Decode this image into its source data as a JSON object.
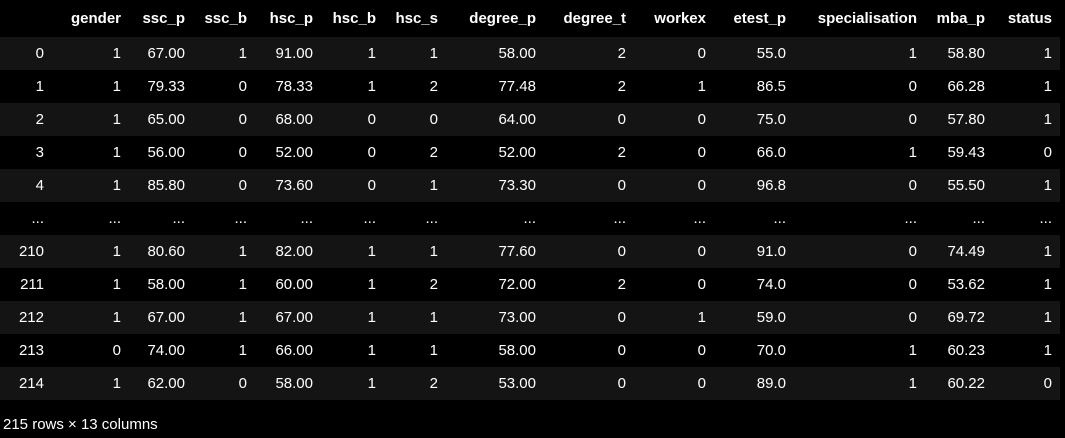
{
  "dataframe": {
    "columns": [
      "",
      "gender",
      "ssc_p",
      "ssc_b",
      "hsc_p",
      "hsc_b",
      "hsc_s",
      "degree_p",
      "degree_t",
      "workex",
      "etest_p",
      "specialisation",
      "mba_p",
      "status"
    ],
    "rows": [
      [
        "0",
        "1",
        "67.00",
        "1",
        "91.00",
        "1",
        "1",
        "58.00",
        "2",
        "0",
        "55.0",
        "1",
        "58.80",
        "1"
      ],
      [
        "1",
        "1",
        "79.33",
        "0",
        "78.33",
        "1",
        "2",
        "77.48",
        "2",
        "1",
        "86.5",
        "0",
        "66.28",
        "1"
      ],
      [
        "2",
        "1",
        "65.00",
        "0",
        "68.00",
        "0",
        "0",
        "64.00",
        "0",
        "0",
        "75.0",
        "0",
        "57.80",
        "1"
      ],
      [
        "3",
        "1",
        "56.00",
        "0",
        "52.00",
        "0",
        "2",
        "52.00",
        "2",
        "0",
        "66.0",
        "1",
        "59.43",
        "0"
      ],
      [
        "4",
        "1",
        "85.80",
        "0",
        "73.60",
        "0",
        "1",
        "73.30",
        "0",
        "0",
        "96.8",
        "0",
        "55.50",
        "1"
      ],
      [
        "...",
        "...",
        "...",
        "...",
        "...",
        "...",
        "...",
        "...",
        "...",
        "...",
        "...",
        "...",
        "...",
        "..."
      ],
      [
        "210",
        "1",
        "80.60",
        "1",
        "82.00",
        "1",
        "1",
        "77.60",
        "0",
        "0",
        "91.0",
        "0",
        "74.49",
        "1"
      ],
      [
        "211",
        "1",
        "58.00",
        "1",
        "60.00",
        "1",
        "2",
        "72.00",
        "2",
        "0",
        "74.0",
        "0",
        "53.62",
        "1"
      ],
      [
        "212",
        "1",
        "67.00",
        "1",
        "67.00",
        "1",
        "1",
        "73.00",
        "0",
        "1",
        "59.0",
        "0",
        "69.72",
        "1"
      ],
      [
        "213",
        "0",
        "74.00",
        "1",
        "66.00",
        "1",
        "1",
        "58.00",
        "0",
        "0",
        "70.0",
        "1",
        "60.23",
        "1"
      ],
      [
        "214",
        "1",
        "62.00",
        "0",
        "58.00",
        "1",
        "2",
        "53.00",
        "0",
        "0",
        "89.0",
        "1",
        "60.22",
        "0"
      ]
    ],
    "shape_text": "215 rows × 13 columns"
  },
  "colors": {
    "background": "#000000",
    "row_stripe": "#141414",
    "text": "#ffffff"
  }
}
